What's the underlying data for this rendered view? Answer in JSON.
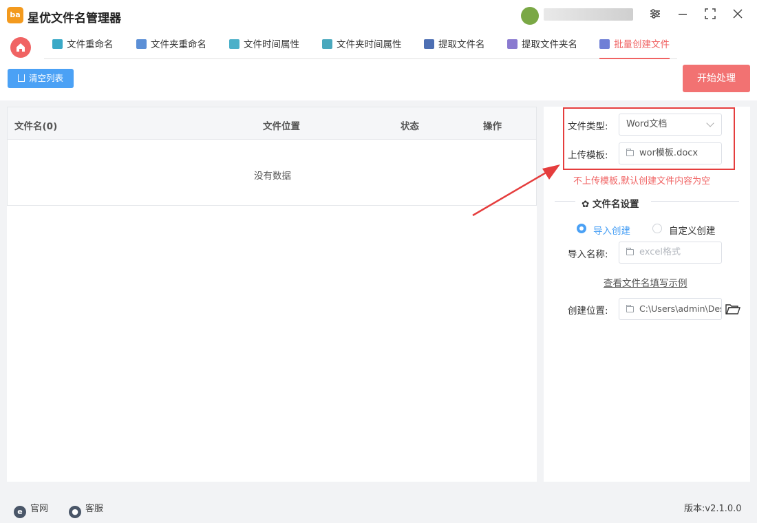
{
  "app": {
    "title": "星优文件名管理器",
    "logo_text": "ba"
  },
  "window_controls": {
    "settings_glyph": "⚙",
    "minimize_glyph": "—",
    "maximize_glyph": "⛶",
    "close_glyph": "✕"
  },
  "tabs": [
    {
      "label": "文件重命名",
      "icon_color": "#3aa9c7"
    },
    {
      "label": "文件夹重命名",
      "icon_color": "#5b8fd6"
    },
    {
      "label": "文件时间属性",
      "icon_color": "#4bb0c9"
    },
    {
      "label": "文件夹时间属性",
      "icon_color": "#49a8bd"
    },
    {
      "label": "提取文件名",
      "icon_color": "#4d6fb3"
    },
    {
      "label": "提取文件夹名",
      "icon_color": "#8a7ad0"
    },
    {
      "label": "批量创建文件",
      "icon_color": "#6f7fd6",
      "active": true
    }
  ],
  "toolbar": {
    "clear_label": "清空列表",
    "start_label": "开始处理"
  },
  "table": {
    "columns": [
      "文件名(0)",
      "文件位置",
      "状态",
      "操作"
    ],
    "empty_text": "没有数据"
  },
  "settings": {
    "file_type_label": "文件类型:",
    "file_type_value": "Word文档",
    "template_label": "上传模板:",
    "template_value": "wor模板.docx",
    "template_note": "不上传模板,默认创建文件内容为空",
    "filename_section_title": "文件名设置",
    "radio_import_label": "导入创建",
    "radio_custom_label": "自定义创建",
    "import_name_label": "导入名称:",
    "import_name_placeholder": "excel格式",
    "example_link": "查看文件名填写示例",
    "location_label": "创建位置:",
    "location_value": "C:\\Users\\admin\\Des"
  },
  "footer": {
    "website_label": "官网",
    "support_label": "客服",
    "version_text": "版本:v2.1.0.0"
  },
  "colors": {
    "accent_red": "#f06363",
    "accent_blue": "#4ba1f5",
    "highlight_box": "#e53d3d"
  }
}
